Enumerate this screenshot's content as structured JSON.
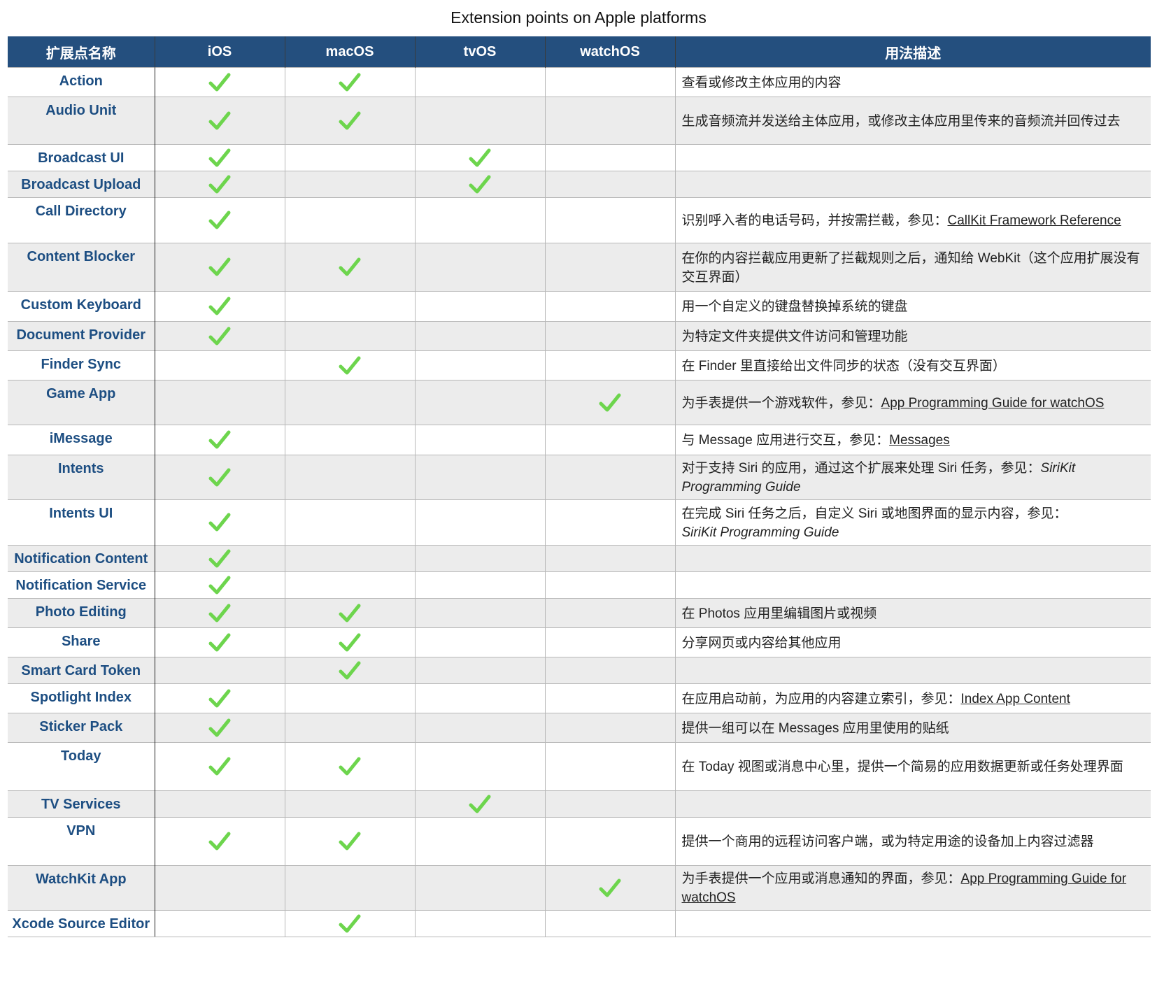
{
  "title": "Extension points on Apple platforms",
  "colors": {
    "header_bg": "#244f7e",
    "name_text": "#1d4e82",
    "check": "#6dd54d",
    "alt_row": "#ececec"
  },
  "icons": {
    "check": "check-icon"
  },
  "headers": [
    "扩展点名称",
    "iOS",
    "macOS",
    "tvOS",
    "watchOS",
    "用法描述"
  ],
  "rows": [
    {
      "name": "Action",
      "ios": true,
      "macos": true,
      "tvos": false,
      "watchos": false,
      "desc": [
        {
          "t": "查看或修改主体应用的内容"
        }
      ]
    },
    {
      "name": "Audio Unit",
      "ios": true,
      "macos": true,
      "tvos": false,
      "watchos": false,
      "desc": [
        {
          "t": "生成音频流并发送给主体应用，或修改主体应用里传来的音频流并回传过去"
        }
      ]
    },
    {
      "name": "Broadcast UI",
      "ios": true,
      "macos": false,
      "tvos": true,
      "watchos": false,
      "desc": []
    },
    {
      "name": "Broadcast Upload",
      "ios": true,
      "macos": false,
      "tvos": true,
      "watchos": false,
      "desc": []
    },
    {
      "name": "Call Directory",
      "ios": true,
      "macos": false,
      "tvos": false,
      "watchos": false,
      "desc": [
        {
          "t": "识别呼入者的电话号码，并按需拦截，参见："
        },
        {
          "t": "CallKit Framework Reference",
          "link": true
        }
      ]
    },
    {
      "name": "Content Blocker",
      "ios": true,
      "macos": true,
      "tvos": false,
      "watchos": false,
      "desc": [
        {
          "t": "在你的内容拦截应用更新了拦截规则之后，通知给 WebKit（这个应用扩展没有交互界面）"
        }
      ]
    },
    {
      "name": "Custom Keyboard",
      "ios": true,
      "macos": false,
      "tvos": false,
      "watchos": false,
      "desc": [
        {
          "t": "用一个自定义的键盘替换掉系统的键盘"
        }
      ]
    },
    {
      "name": "Document Provider",
      "ios": true,
      "macos": false,
      "tvos": false,
      "watchos": false,
      "desc": [
        {
          "t": "为特定文件夹提供文件访问和管理功能"
        }
      ]
    },
    {
      "name": "Finder Sync",
      "ios": false,
      "macos": true,
      "tvos": false,
      "watchos": false,
      "desc": [
        {
          "t": "在 Finder 里直接给出文件同步的状态（没有交互界面）"
        }
      ]
    },
    {
      "name": "Game App",
      "ios": false,
      "macos": false,
      "tvos": false,
      "watchos": true,
      "desc": [
        {
          "t": "为手表提供一个游戏软件，参见："
        },
        {
          "t": "App Programming Guide for watchOS",
          "link": true
        }
      ]
    },
    {
      "name": "iMessage",
      "ios": true,
      "macos": false,
      "tvos": false,
      "watchos": false,
      "desc": [
        {
          "t": "与 Message 应用进行交互，参见："
        },
        {
          "t": "Messages",
          "link": true
        }
      ]
    },
    {
      "name": "Intents",
      "ios": true,
      "macos": false,
      "tvos": false,
      "watchos": false,
      "desc": [
        {
          "t": "对于支持 Siri 的应用，通过这个扩展来处理 Siri 任务，参见："
        },
        {
          "t": "SiriKit Programming Guide",
          "italic": true
        }
      ]
    },
    {
      "name": "Intents UI",
      "ios": true,
      "macos": false,
      "tvos": false,
      "watchos": false,
      "desc": [
        {
          "t": "在完成 Siri 任务之后，自定义 Siri 或地图界面的显示内容，参见："
        },
        {
          "t": "SiriKit Programming Guide",
          "italic": true,
          "newline": true
        }
      ]
    },
    {
      "name": "Notification Content",
      "ios": true,
      "macos": false,
      "tvos": false,
      "watchos": false,
      "desc": []
    },
    {
      "name": "Notification Service",
      "ios": true,
      "macos": false,
      "tvos": false,
      "watchos": false,
      "desc": []
    },
    {
      "name": "Photo Editing",
      "ios": true,
      "macos": true,
      "tvos": false,
      "watchos": false,
      "desc": [
        {
          "t": "在 Photos 应用里编辑图片或视频"
        }
      ]
    },
    {
      "name": "Share",
      "ios": true,
      "macos": true,
      "tvos": false,
      "watchos": false,
      "desc": [
        {
          "t": "分享网页或内容给其他应用"
        }
      ]
    },
    {
      "name": "Smart Card Token",
      "ios": false,
      "macos": true,
      "tvos": false,
      "watchos": false,
      "desc": []
    },
    {
      "name": "Spotlight Index",
      "ios": true,
      "macos": false,
      "tvos": false,
      "watchos": false,
      "desc": [
        {
          "t": "在应用启动前，为应用的内容建立索引，参见："
        },
        {
          "t": "Index App Content",
          "link": true
        }
      ]
    },
    {
      "name": "Sticker Pack",
      "ios": true,
      "macos": false,
      "tvos": false,
      "watchos": false,
      "desc": [
        {
          "t": "提供一组可以在 Messages 应用里使用的贴纸"
        }
      ]
    },
    {
      "name": "Today",
      "ios": true,
      "macos": true,
      "tvos": false,
      "watchos": false,
      "desc": [
        {
          "t": "在 Today 视图或消息中心里，提供一个简易的应用数据更新或任务处理界面"
        }
      ]
    },
    {
      "name": "TV Services",
      "ios": false,
      "macos": false,
      "tvos": true,
      "watchos": false,
      "desc": []
    },
    {
      "name": "VPN",
      "ios": true,
      "macos": true,
      "tvos": false,
      "watchos": false,
      "desc": [
        {
          "t": "提供一个商用的远程访问客户端，或为特定用途的设备加上内容过滤器"
        }
      ]
    },
    {
      "name": "WatchKit App",
      "ios": false,
      "macos": false,
      "tvos": false,
      "watchos": true,
      "desc": [
        {
          "t": "为手表提供一个应用或消息通知的界面，参见："
        },
        {
          "t": "App Programming Guide for watchOS",
          "link": true
        }
      ]
    },
    {
      "name": "Xcode Source Editor",
      "ios": false,
      "macos": true,
      "tvos": false,
      "watchos": false,
      "desc": []
    }
  ]
}
